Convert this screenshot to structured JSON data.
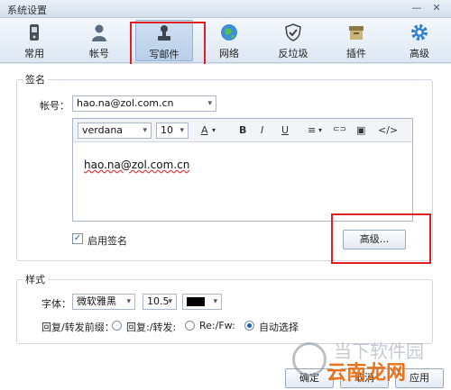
{
  "window": {
    "title": "系统设置",
    "min_glyph": "—",
    "close_glyph": "✕"
  },
  "toolbar": {
    "items": [
      {
        "label": "常用",
        "icon": "phone-icon"
      },
      {
        "label": "帐号",
        "icon": "user-icon"
      },
      {
        "label": "写邮件",
        "icon": "stamp-icon"
      },
      {
        "label": "网络",
        "icon": "globe-icon"
      },
      {
        "label": "反垃圾",
        "icon": "shield-icon"
      },
      {
        "label": "插件",
        "icon": "box-icon"
      },
      {
        "label": "高级",
        "icon": "gear-icon"
      }
    ],
    "active_index": 2
  },
  "signature": {
    "legend": "签名",
    "account_label": "帐号：",
    "account_value": "hao.na@zol.com.cn",
    "font_family": "verdana",
    "font_size": "10",
    "toolbar_glyphs": {
      "text_color": "A",
      "bold": "B",
      "italic": "I",
      "underline": "U",
      "align": "≡",
      "link": "⊂⊃",
      "image": "▣",
      "code": "</>"
    },
    "content": "hao.na@zol.com.cn",
    "enable_label": "启用签名",
    "enable_checked": true,
    "advanced_button": "高级..."
  },
  "style": {
    "legend": "样式",
    "font_label": "字体：",
    "font_value": "微软雅黑",
    "size_value": "10.5",
    "prefix_label": "回复/转发前缀：",
    "options": [
      "回复:/转发:",
      "Re:/Fw:",
      "自动选择"
    ],
    "selected_index": 2
  },
  "footer": {
    "ok": "确定",
    "cancel": "取消",
    "apply": "应用"
  },
  "watermark": {
    "line1": "当下软件园",
    "line2": "云南龙网"
  },
  "colors": {
    "highlight": "#e02020",
    "accent": "#1c5fb0"
  }
}
